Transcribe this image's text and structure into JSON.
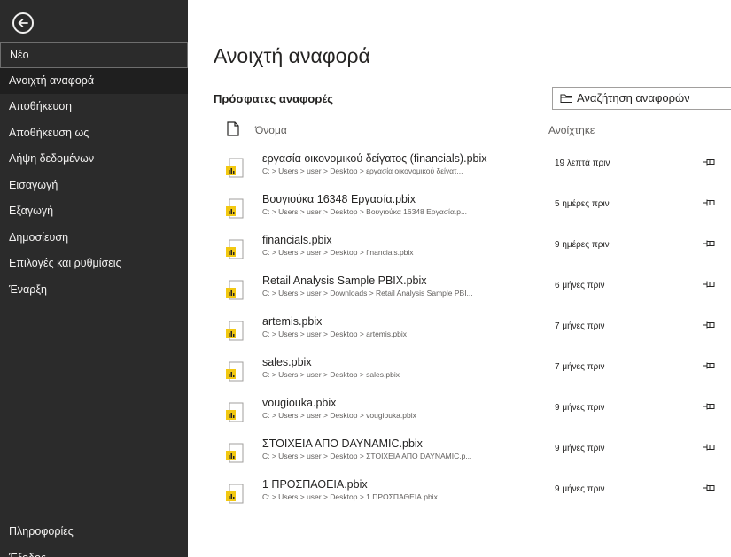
{
  "sidebar": {
    "items": [
      {
        "label": "Νέο"
      },
      {
        "label": "Ανοιχτή αναφορά"
      },
      {
        "label": "Αποθήκευση"
      },
      {
        "label": "Αποθήκευση ως"
      },
      {
        "label": "Λήψη δεδομένων"
      },
      {
        "label": "Εισαγωγή"
      },
      {
        "label": "Εξαγωγή"
      },
      {
        "label": "Δημοσίευση"
      },
      {
        "label": "Επιλογές και ρυθμίσεις"
      },
      {
        "label": "Έναρξη"
      }
    ],
    "bottom": [
      {
        "label": "Πληροφορίες"
      },
      {
        "label": "Έξοδος"
      }
    ]
  },
  "main": {
    "title": "Ανοιχτή αναφορά",
    "section_title": "Πρόσφατες αναφορές",
    "browse_label": "Αναζήτηση αναφορών",
    "col_name": "Όνομα",
    "col_opened": "Ανοίχτηκε",
    "files": [
      {
        "name": "εργασία οικονομικού δείγατος (financials).pbix",
        "path": "C: > Users > user > Desktop > εργασία οικονομικού δείγατ...",
        "opened": "19 λεπτά πριν"
      },
      {
        "name": "Βουγιούκα 16348 Εργασία.pbix",
        "path": "C: > Users > user > Desktop > Βουγιούκα 16348 Εργασία.p...",
        "opened": "5 ημέρες πριν"
      },
      {
        "name": "financials.pbix",
        "path": "C: > Users > user > Desktop > financials.pbix",
        "opened": "9 ημέρες πριν"
      },
      {
        "name": "Retail Analysis Sample PBIX.pbix",
        "path": "C: > Users > user > Downloads > Retail Analysis Sample PBI...",
        "opened": "6 μήνες πριν"
      },
      {
        "name": "artemis.pbix",
        "path": "C: > Users > user > Desktop > artemis.pbix",
        "opened": "7 μήνες πριν"
      },
      {
        "name": "sales.pbix",
        "path": "C: > Users > user > Desktop > sales.pbix",
        "opened": "7 μήνες πριν"
      },
      {
        "name": "vougiouka.pbix",
        "path": "C: > Users > user > Desktop > vougiouka.pbix",
        "opened": "9 μήνες πριν"
      },
      {
        "name": "ΣΤΟΙΧΕΙΑ ΑΠΟ DAYNAMIC.pbix",
        "path": "C: > Users > user > Desktop > ΣΤΟΙΧΕΙΑ ΑΠΟ DAYNAMIC.p...",
        "opened": "9 μήνες πριν"
      },
      {
        "name": "1 ΠΡΟΣΠΑΘΕΙΑ.pbix",
        "path": "C: > Users > user > Desktop > 1 ΠΡΟΣΠΑΘΕΙΑ.pbix",
        "opened": "9 μήνες πριν"
      }
    ]
  },
  "colors": {
    "sidebar_bg": "#2b2b2b",
    "active_bg": "#1f1f1f",
    "pbix_icon": "#f2c811"
  }
}
